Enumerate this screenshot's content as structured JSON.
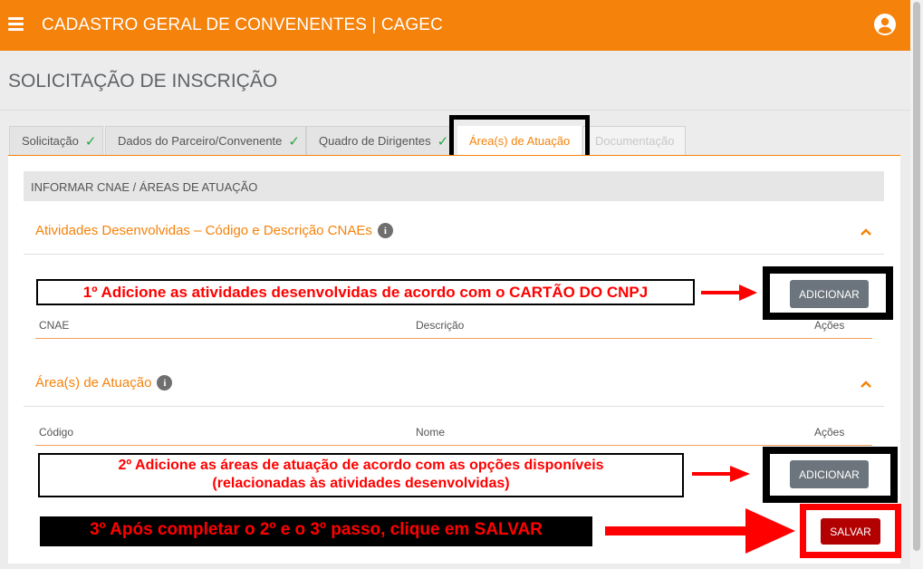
{
  "header": {
    "app_title": "CADASTRO GERAL DE CONVENENTES | CAGEC",
    "brand_color": "#f5820b",
    "menu_icon": "hamburger-icon",
    "user_icon": "user-circle-icon"
  },
  "page": {
    "title": "SOLICITAÇÃO DE INSCRIÇÃO"
  },
  "tabs": [
    {
      "label": "Solicitação",
      "completed": true
    },
    {
      "label": "Dados do Parceiro/Convenente",
      "completed": true
    },
    {
      "label": "Quadro de Dirigentes",
      "completed": true
    },
    {
      "label": "Área(s) de Atuação",
      "active": true
    },
    {
      "label": "Documentação",
      "disabled": true
    }
  ],
  "section": {
    "header": "INFORMAR CNAE / ÁREAS DE ATUAÇÃO"
  },
  "cnae": {
    "title": "Atividades Desenvolvidas – Código e Descrição CNAEs",
    "add_label": "ADICIONAR",
    "columns": [
      "CNAE",
      "Descrição",
      "Ações"
    ]
  },
  "areas": {
    "title": "Área(s) de Atuação",
    "add_label": "ADICIONAR",
    "columns": [
      "Código",
      "Nome",
      "Ações"
    ]
  },
  "save_label": "SALVAR",
  "annotations": {
    "step1": "1º Adicione as atividades desenvolvidas de acordo com o CARTÃO DO CNPJ",
    "step2_line1": "2º Adicione as áreas de atuação de acordo com as opções disponíveis",
    "step2_line2": "(relacionadas às atividades desenvolvidas)",
    "step3": "3º Após completar o 2º e o 3º passo, clique em SALVAR",
    "annotation_color": "#ff0000"
  }
}
